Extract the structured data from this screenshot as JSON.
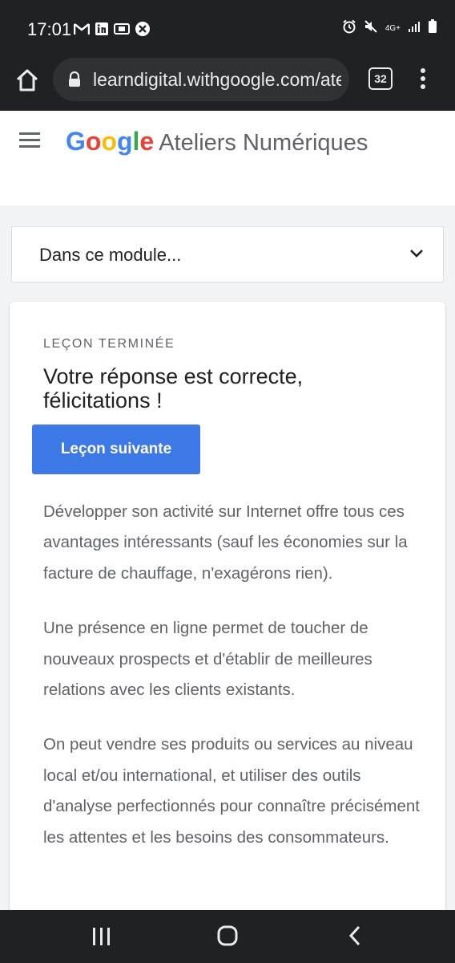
{
  "status_bar": {
    "time": "17:01",
    "left_icons": [
      "gmail-icon",
      "linkedin-icon",
      "cast-icon",
      "x-close-icon"
    ],
    "right_icons": [
      "alarm-icon",
      "mute-icon",
      "network-4g-icon",
      "signal-icon",
      "battery-icon"
    ],
    "network_label": "4G+"
  },
  "browser": {
    "url": "learndigital.withgoogle.com/ateliersnumeriques",
    "tab_count": "32"
  },
  "site": {
    "logo_google": [
      "G",
      "o",
      "o",
      "g",
      "l",
      "e"
    ],
    "logo_colors": [
      "#4285f4",
      "#ea4335",
      "#fbbc05",
      "#4285f4",
      "#34a853",
      "#ea4335"
    ],
    "site_name": "Ateliers Numériques"
  },
  "module_dropdown": {
    "label": "Dans ce module..."
  },
  "lesson": {
    "status": "LEÇON TERMINÉE",
    "heading": "Votre réponse est correcte, félicitations !",
    "next_button": "Leçon suivante",
    "paragraphs": [
      "Développer son activité sur Internet offre tous ces avantages intéressants (sauf les économies sur la facture de chauffage, n'exagérons rien).",
      "Une présence en ligne permet de toucher de nouveaux prospects et d'établir de meilleures relations avec les clients existants.",
      "On peut vendre ses produits ou services au niveau local et/ou international, et utiliser des outils d'analyse perfectionnés pour connaître précisément les attentes et les besoins des consommateurs."
    ]
  },
  "colors": {
    "accent_blue": "#3c78e6",
    "system_bar": "#202124",
    "body_text": "#5f6368"
  },
  "nav_bar": {
    "buttons": [
      "recent-apps-icon",
      "home-icon",
      "back-icon"
    ]
  }
}
